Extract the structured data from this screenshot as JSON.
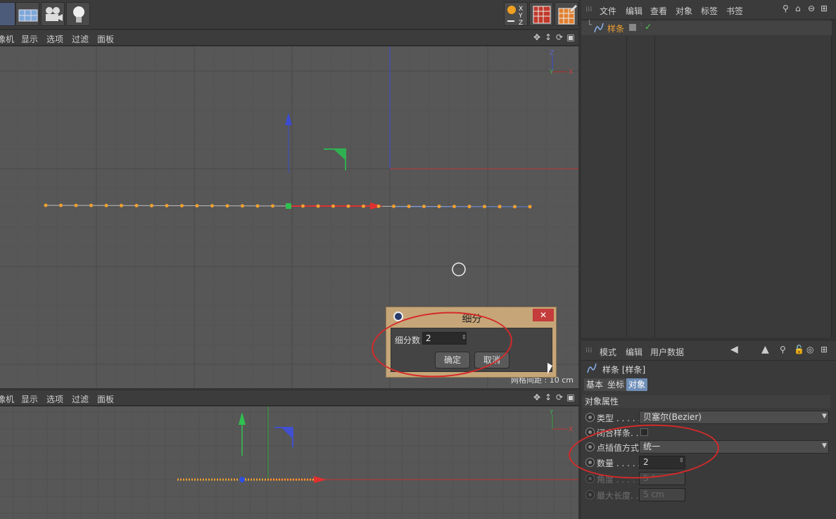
{
  "viewport_menu": [
    "像机",
    "显示",
    "选项",
    "过滤",
    "面板"
  ],
  "object_manager": {
    "menu": [
      "文件",
      "编辑",
      "查看",
      "对象",
      "标签",
      "书签"
    ],
    "object_name": "样条"
  },
  "attributes": {
    "menu": [
      "模式",
      "编辑",
      "用户数据"
    ],
    "object_title": "样条 [样条]",
    "tabs": [
      "基本",
      "坐标",
      "对象"
    ],
    "section_title": "对象属性",
    "rows": [
      {
        "label": "类型 . . . . .",
        "value": "贝塞尔(Bezier)"
      },
      {
        "label": "闭合样条. . .",
        "value": ""
      },
      {
        "label": "点插值方式",
        "value": "统一"
      },
      {
        "label": "数量 . . . . .",
        "value": "2"
      },
      {
        "label": "角度 . . . . .",
        "value": "5 °"
      },
      {
        "label": "最大长度. .",
        "value": "5 cm"
      }
    ]
  },
  "dialog": {
    "title": "细分",
    "field_label": "细分数",
    "field_value": "2",
    "ok": "确定",
    "cancel": "取消",
    "close": "✕"
  },
  "viewport1": {
    "grid_spacing": "网格间距 : 10 cm",
    "axis": {
      "x": "X",
      "y": "Y",
      "z": "Z"
    }
  },
  "viewport2": {
    "axis": {
      "x": "X",
      "y": "Y"
    }
  },
  "colors": {
    "accent": "#e05050",
    "spline": "#f0a030",
    "selected_tab": "#6f8fb8"
  }
}
